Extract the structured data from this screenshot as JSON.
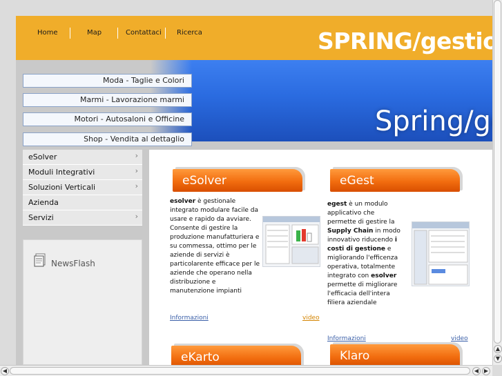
{
  "header": {
    "nav": [
      "Home",
      "Map",
      "Contattaci",
      "Ricerca"
    ],
    "brand": "SPRING/gestio"
  },
  "banner": {
    "brand": "Spring/ge",
    "quick_links": [
      "Moda - Taglie e Colori",
      "Marmi - Lavorazione marmi",
      "Motori - Autosaloni e Officine",
      "Shop - Vendita al dettaglio"
    ]
  },
  "menu": {
    "items": [
      "eSolver",
      "Moduli Integrativi",
      "Soluzioni Verticali",
      "Azienda",
      "Servizi"
    ],
    "arrow": "›"
  },
  "newsflash": {
    "label": "NewsFlash"
  },
  "products": {
    "esolver": {
      "title": "eSolver",
      "bold": "esolver",
      "text": " è gestionale integrato modulare facile da usare e rapido da avviare. Consente di gestire la produzione manufatturiera e su commessa, ottimo per le aziende di servizi è particolarente efficace per le aziende  che operano nella distribuzione e manutenzione impianti",
      "info": "Informazioni",
      "video": "video"
    },
    "egest": {
      "title": "eGest",
      "bold1": "egest",
      "t1": " è un modulo applicativo che permette di gestire la ",
      "bold2": "Supply Chain",
      "t2": " in modo innovativo riducendo ",
      "bold3": "i costi di gestione",
      "t3": " e migliorando l'efficenza operativa, totalmente integrato con ",
      "bold4": "esolver",
      "t4": " permette di migliorare l'efficacia dell'intera filiera aziendale",
      "info": "Informazioni",
      "video": "video"
    },
    "ekarto": {
      "title": "eKarto"
    },
    "klaro": {
      "title": "Klaro"
    }
  },
  "colors": {
    "header_bg": "#f0ad2a",
    "product_orange": "#f26d0f",
    "banner_blue": "#2a6be0"
  }
}
